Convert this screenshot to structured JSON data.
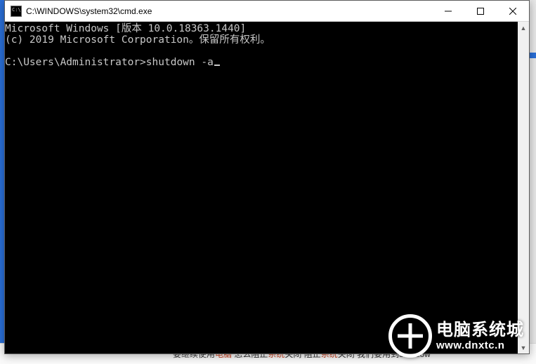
{
  "window": {
    "title": "C:\\WINDOWS\\system32\\cmd.exe"
  },
  "terminal": {
    "line1": "Microsoft Windows [版本 10.0.18363.1440]",
    "line2": "(c) 2019 Microsoft Corporation。保留所有权利。",
    "prompt": "C:\\Users\\Administrator>",
    "command": "shutdown -a"
  },
  "watermark": {
    "cn": "电脑系统城",
    "en": "www.dnxtc.n"
  },
  "background": {
    "snippet_prefix": "要继续使用",
    "snippet_hl1": "电脑",
    "snippet_mid": " 怎么阻止",
    "snippet_hl2": "系统",
    "snippet_mid2": "关闭 阻止",
    "snippet_hl3": "系统",
    "snippet_suffix": "关闭 我们要用到shutdow"
  }
}
